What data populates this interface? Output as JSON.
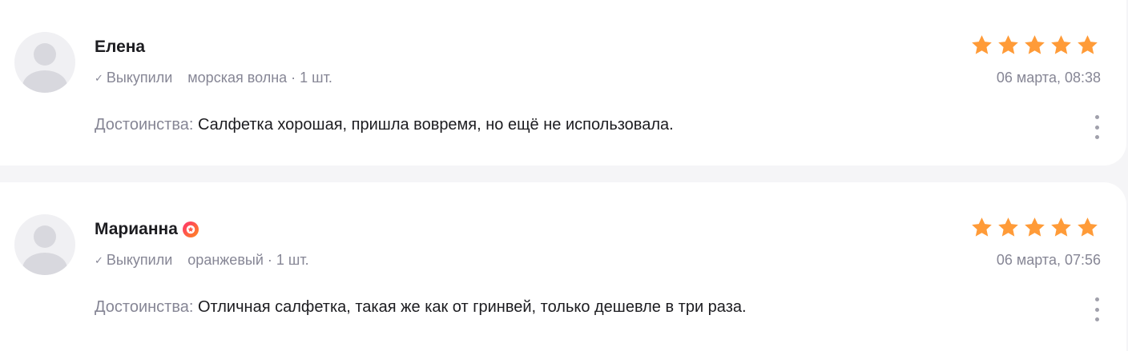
{
  "reviews": [
    {
      "author": "Елена",
      "purchased_label": "Выкупили",
      "variant": "морская волна · 1 шт.",
      "date": "06 марта, 08:38",
      "rating": 5,
      "pros_label": "Достоинства:",
      "pros_text": "Салфетка хорошая, пришла вовремя, но ещё не использовала."
    },
    {
      "author": "Марианна",
      "purchased_label": "Выкупили",
      "variant": "оранжевый · 1 шт.",
      "date": "06 марта, 07:56",
      "rating": 5,
      "pros_label": "Достоинства:",
      "pros_text": "Отличная салфетка, такая же как от гринвей, только дешевле в три раза."
    }
  ],
  "colors": {
    "star": "#ff9b38",
    "muted_text": "#868695",
    "main_text": "#1c1c20",
    "badge_gradient_start": "#ff2f6e",
    "badge_gradient_end": "#ff8a1f"
  },
  "icons": {
    "avatar": "user-placeholder-icon",
    "check": "check-icon",
    "star": "star-icon",
    "badge": "star-badge-icon",
    "more": "more-vertical-icon"
  }
}
